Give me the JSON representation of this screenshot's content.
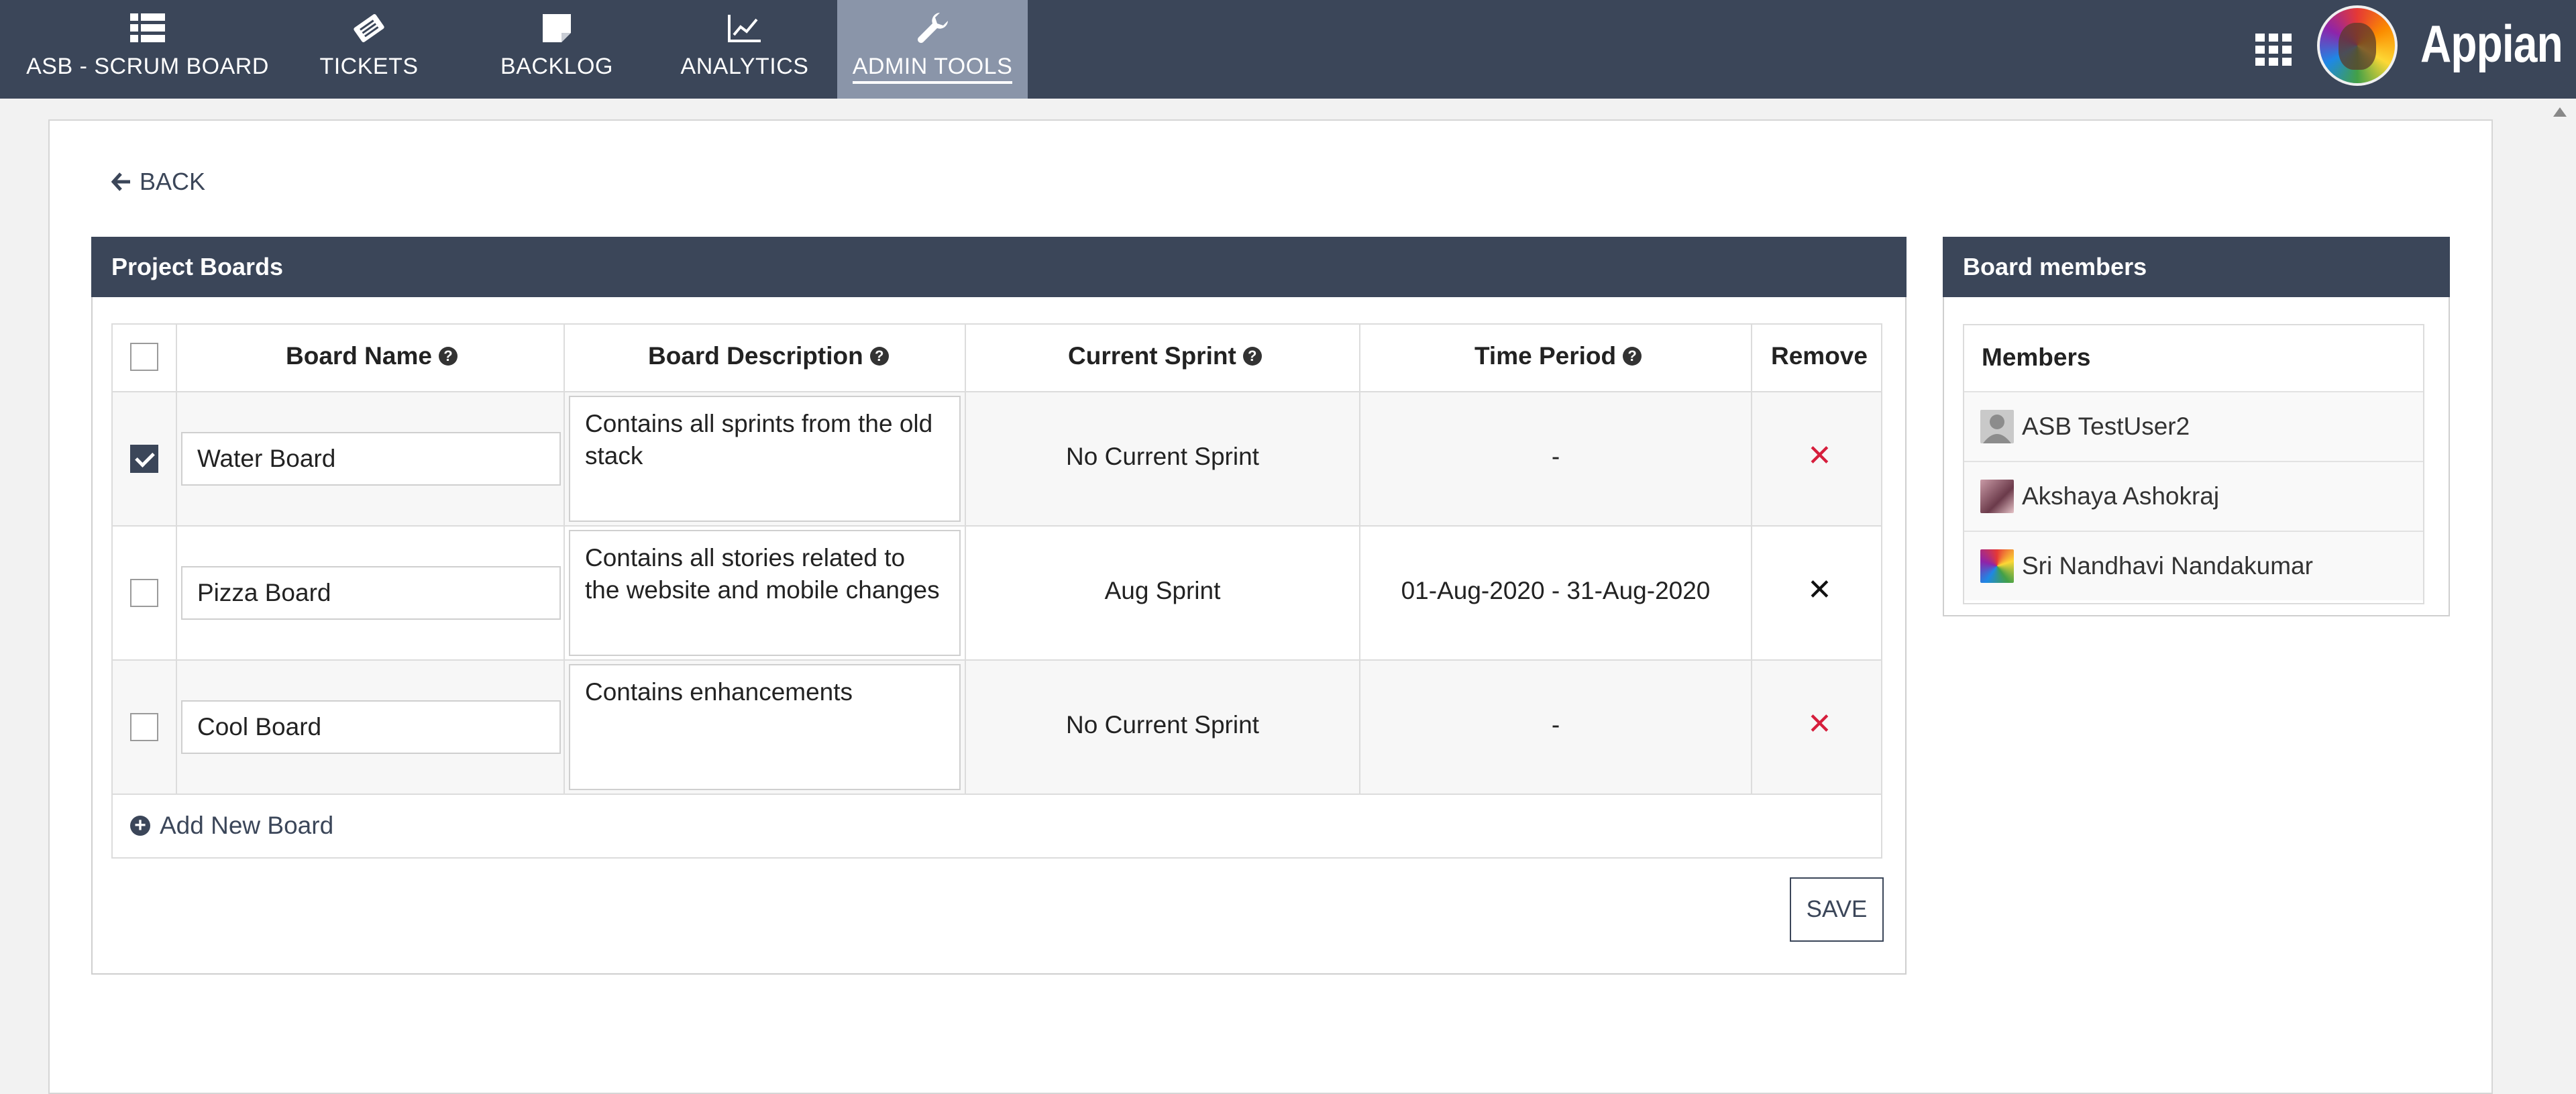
{
  "nav": {
    "tabs": [
      {
        "label": "ASB - SCRUM BOARD",
        "icon": "list-icon",
        "active": false
      },
      {
        "label": "TICKETS",
        "icon": "ticket-icon",
        "active": false
      },
      {
        "label": "BACKLOG",
        "icon": "note-icon",
        "active": false
      },
      {
        "label": "ANALYTICS",
        "icon": "line-chart-icon",
        "active": false
      },
      {
        "label": "ADMIN TOOLS",
        "icon": "wrench-icon",
        "active": true
      }
    ],
    "brand": "Appian"
  },
  "back_label": "BACK",
  "project_boards": {
    "title": "Project Boards",
    "columns": [
      "Board Name",
      "Board Description",
      "Current Sprint",
      "Time Period",
      "Remove"
    ],
    "rows": [
      {
        "checked": true,
        "name": "Water Board",
        "description": "Contains all sprints from the old stack",
        "sprint": "No Current Sprint",
        "period": "-",
        "remove_color": "#d61e3c"
      },
      {
        "checked": false,
        "name": "Pizza Board",
        "description": "Contains all stories related to the website and mobile changes",
        "sprint": "Aug Sprint",
        "period": "01-Aug-2020 - 31-Aug-2020",
        "remove_color": "#111111"
      },
      {
        "checked": false,
        "name": "Cool Board",
        "description": "Contains enhancements",
        "sprint": "No Current Sprint",
        "period": "-",
        "remove_color": "#d61e3c"
      }
    ],
    "add_label": "Add New Board",
    "save_label": "SAVE"
  },
  "board_members": {
    "title": "Board members",
    "column": "Members",
    "members": [
      {
        "name": "ASB TestUser2",
        "avatar": "default-user-icon"
      },
      {
        "name": "Akshaya Ashokraj",
        "avatar": "photo-avatar"
      },
      {
        "name": "Sri Nandhavi Nandakumar",
        "avatar": "colorful-avatar"
      }
    ]
  },
  "colors": {
    "header": "#3b4659",
    "active_tab": "#8a95a9",
    "remove_red": "#d61e3c"
  }
}
